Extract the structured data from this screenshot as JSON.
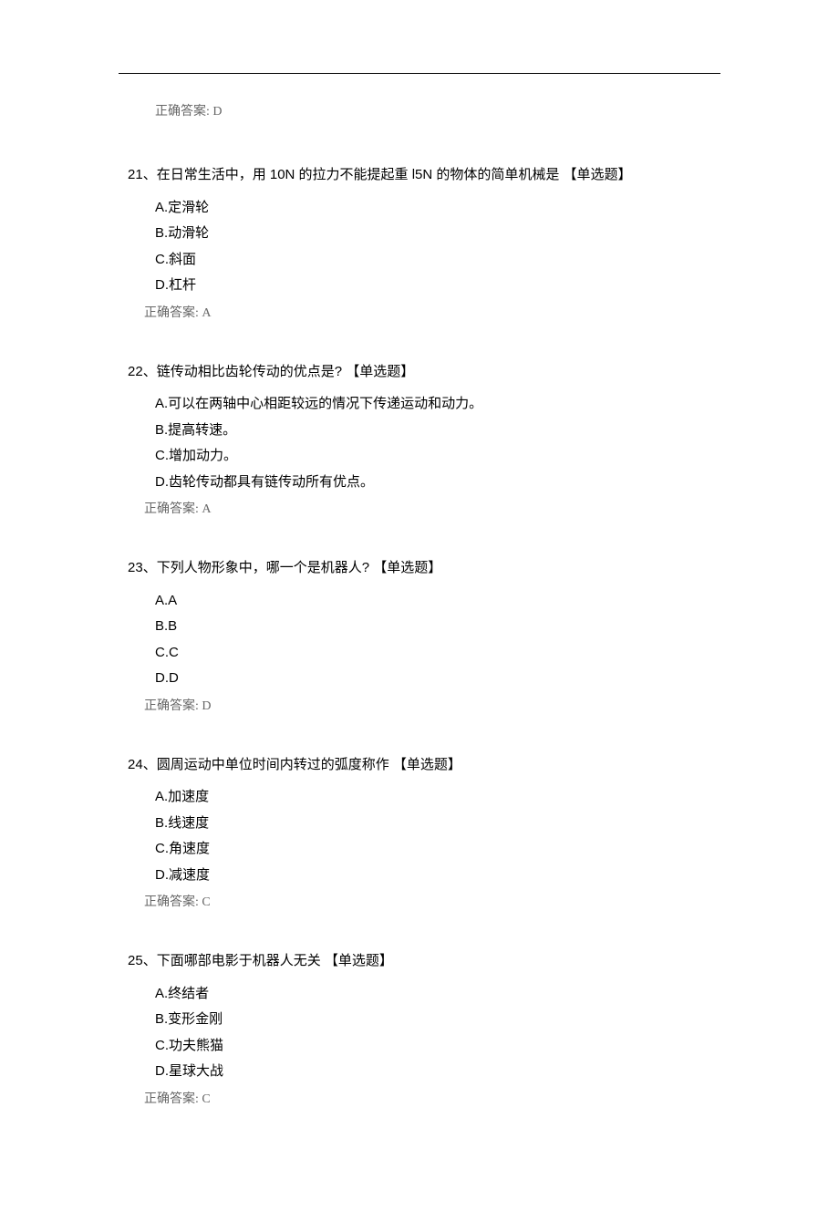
{
  "prev_answer": "正确答案: D",
  "questions": [
    {
      "number": "21",
      "text": "、在日常生活中，用 10N 的拉力不能提起重 l5N 的物体的简单机械是 【单选题】",
      "options": [
        "A.定滑轮",
        "B.动滑轮",
        "C.斜面",
        "D.杠杆"
      ],
      "answer": "正确答案: A"
    },
    {
      "number": "22",
      "text": "、链传动相比齿轮传动的优点是? 【单选题】",
      "options": [
        "A.可以在两轴中心相距较远的情况下传递运动和动力。",
        "B.提高转速。",
        "C.增加动力。",
        "D.齿轮传动都具有链传动所有优点。"
      ],
      "answer": "正确答案: A"
    },
    {
      "number": "23",
      "text": "、下列人物形象中，哪一个是机器人? 【单选题】",
      "options": [
        "A.A",
        "B.B",
        "C.C",
        "D.D"
      ],
      "answer": "正确答案: D"
    },
    {
      "number": "24",
      "text": "、圆周运动中单位时间内转过的弧度称作 【单选题】",
      "options": [
        "A.加速度",
        "B.线速度",
        "C.角速度",
        "D.减速度"
      ],
      "answer": "正确答案: C"
    },
    {
      "number": "25",
      "text": "、下面哪部电影于机器人无关 【单选题】",
      "options": [
        "A.终结者",
        "B.变形金刚",
        "C.功夫熊猫",
        "D.星球大战"
      ],
      "answer": "正确答案: C"
    }
  ]
}
